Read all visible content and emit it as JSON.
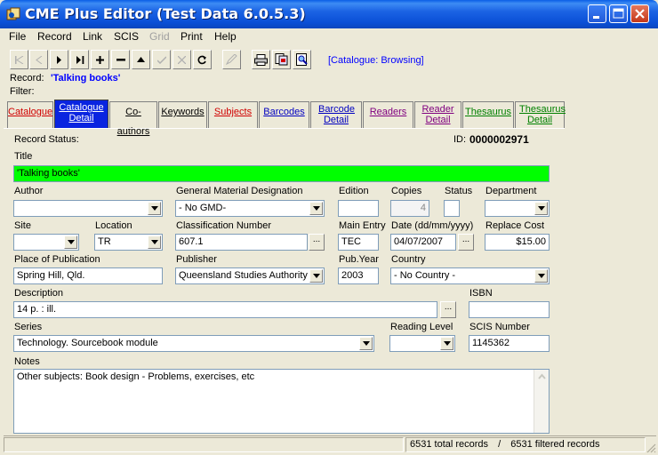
{
  "window": {
    "title": "CME Plus Editor  (Test Data 6.0.5.3)"
  },
  "menu": [
    "File",
    "Record",
    "Link",
    "SCIS",
    "Grid",
    "Print",
    "Help"
  ],
  "menu_disabled": [
    "Grid"
  ],
  "toolbar": {
    "mode_text": "[Catalogue: Browsing]"
  },
  "record": {
    "label": "Record:",
    "value": "'Talking books'",
    "filter_label": "Filter:"
  },
  "tabs": [
    {
      "label": "Catalogue",
      "color": "#d00000"
    },
    {
      "label": "Catalogue Detail",
      "color": "#ffffff"
    },
    {
      "label": "Co-authors",
      "color": "#000000"
    },
    {
      "label": "Keywords",
      "color": "#000000"
    },
    {
      "label": "Subjects",
      "color": "#d00000"
    },
    {
      "label": "Barcodes",
      "color": "#0000c0"
    },
    {
      "label": "Barcode Detail",
      "color": "#0000c0"
    },
    {
      "label": "Readers",
      "color": "#800080"
    },
    {
      "label": "Reader Detail",
      "color": "#800080"
    },
    {
      "label": "Thesaurus",
      "color": "#008000"
    },
    {
      "label": "Thesaurus Detail",
      "color": "#008000"
    }
  ],
  "form": {
    "record_status_label": "Record Status:",
    "id_label": "ID:",
    "id_value": "0000002971",
    "title_label": "Title",
    "title_value": "'Talking books'",
    "author_label": "Author",
    "author_value": "",
    "gmd_label": "General Material Designation",
    "gmd_value": "- No GMD-",
    "edition_label": "Edition",
    "edition_value": "",
    "copies_label": "Copies",
    "copies_value": "4",
    "status_label": "Status",
    "status_value": "",
    "department_label": "Department",
    "department_value": "",
    "site_label": "Site",
    "site_value": "",
    "location_label": "Location",
    "location_value": "TR",
    "classification_label": "Classification Number",
    "classification_value": "607.1",
    "main_entry_label": "Main Entry",
    "main_entry_value": "TEC",
    "date_label": "Date (dd/mm/yyyy)",
    "date_value": "04/07/2007",
    "replace_cost_label": "Replace Cost",
    "replace_cost_value": "$15.00",
    "place_label": "Place of Publication",
    "place_value": "Spring Hill, Qld.",
    "publisher_label": "Publisher",
    "publisher_value": "Queensland Studies Authority",
    "pubyear_label": "Pub.Year",
    "pubyear_value": "2003",
    "country_label": "Country",
    "country_value": "- No Country -",
    "description_label": "Description",
    "description_value": "14 p. : ill.",
    "isbn_label": "ISBN",
    "isbn_value": "",
    "series_label": "Series",
    "series_value": "Technology. Sourcebook module",
    "reading_level_label": "Reading Level",
    "reading_level_value": "",
    "scis_label": "SCIS Number",
    "scis_value": "1145362",
    "notes_label": "Notes",
    "notes_value": "Other subjects: Book design - Problems, exercises, etc"
  },
  "status_bar": {
    "total": "6531 total records",
    "separator": "/",
    "filtered": "6531 filtered records"
  },
  "colors": {
    "title_highlight": "#00ff00",
    "tab_active": "#0a24e0"
  }
}
